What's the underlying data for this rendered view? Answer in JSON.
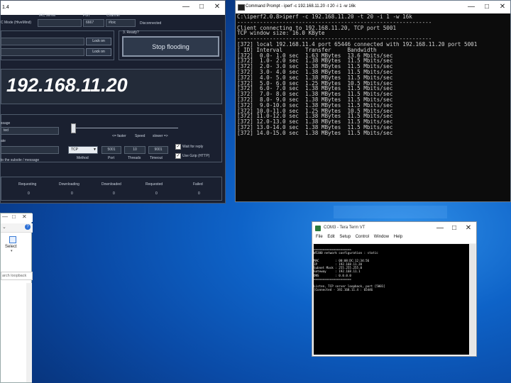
{
  "loic": {
    "title_fragment": "1.4",
    "irc_mode_label": "C Mode (HiveMind)",
    "irc_server_label": "IRC server",
    "port_label": "Port",
    "port_value": "6667",
    "channel_label": "Channel",
    "channel_value": "#loic",
    "disconnected": "Disconnected",
    "lock_on_1": "Lock on",
    "lock_on_2": "Lock on",
    "ready_label": "3. Ready?",
    "stop_flooding": "Stop flooding",
    "target_ip": "192.168.11.20",
    "message_label": "ssage",
    "message_value": "ted",
    "subsite_label": "ate",
    "subsite_note": "to the subsite / message",
    "faster_label": "<= faster",
    "speed_label": "Speed",
    "slower_label": "slower =>",
    "method_value": "TCP",
    "method_label": "Method",
    "port2_value": "5001",
    "port2_label": "Port",
    "threads_value": "10",
    "threads_label": "Threads",
    "timeout_value": "9001",
    "timeout_label": "Timeout",
    "wait_reply": "Wait for reply",
    "use_gzip": "Use Gzip (HTTP)",
    "stats": {
      "headers": [
        "Requesting",
        "Downloading",
        "Downloaded",
        "Requested",
        "Failed"
      ],
      "values": [
        "0",
        "0",
        "0",
        "0",
        "0"
      ],
      "first_value": "0"
    }
  },
  "cmd": {
    "title": "Command Prompt - iperf -c 192.168.11.20 -t 20 -i 1 -w 16k",
    "lines": [
      "C:\\iperf2.0.8>iperf -c 192.168.11.20 -t 20 -i 1 -w 16k",
      "------------------------------------------------------------",
      "Client connecting to 192.168.11.20, TCP port 5001",
      "TCP window size: 16.0 KByte",
      "------------------------------------------------------------",
      "[372] local 192.168.11.4 port 65446 connected with 192.168.11.20 port 5001",
      "[ ID] Interval       Transfer     Bandwidth",
      "[372]  0.0- 1.0 sec  1.63 MBytes  13.6 Mbits/sec",
      "[372]  1.0- 2.0 sec  1.38 MBytes  11.5 Mbits/sec",
      "[372]  2.0- 3.0 sec  1.38 MBytes  11.5 Mbits/sec",
      "[372]  3.0- 4.0 sec  1.38 MBytes  11.5 Mbits/sec",
      "[372]  4.0- 5.0 sec  1.38 MBytes  11.5 Mbits/sec",
      "[372]  5.0- 6.0 sec  1.25 MBytes  10.5 Mbits/sec",
      "[372]  6.0- 7.0 sec  1.38 MBytes  11.5 Mbits/sec",
      "[372]  7.0- 8.0 sec  1.38 MBytes  11.5 Mbits/sec",
      "[372]  8.0- 9.0 sec  1.38 MBytes  11.5 Mbits/sec",
      "[372]  9.0-10.0 sec  1.38 MBytes  11.5 Mbits/sec",
      "[372] 10.0-11.0 sec  1.25 MBytes  10.5 Mbits/sec",
      "[372] 11.0-12.0 sec  1.38 MBytes  11.5 Mbits/sec",
      "[372] 12.0-13.0 sec  1.38 MBytes  11.5 Mbits/sec",
      "[372] 13.0-14.0 sec  1.38 MBytes  11.5 Mbits/sec",
      "[372] 14.0-15.0 sec  1.38 MBytes  11.5 Mbits/sec"
    ]
  },
  "explorer": {
    "select_label": "Select",
    "search_placeholder": "arch loopback"
  },
  "tera": {
    "title": "COM3 - Tera Term VT",
    "menu": [
      "File",
      "Edit",
      "Setup",
      "Control",
      "Window",
      "Help"
    ],
    "lines": [
      "",
      "=====================",
      "W5300 network configuration : static",
      "",
      "MAC         : 00:08:DC:12:34:56",
      "IP          : 192.168.11.20",
      "Subnet Mask : 255.255.255.0",
      "Gateway     : 192.168.11.1",
      "DNS         : 0.0.0.0",
      "=====================",
      "",
      "Listen, TCP server loopback, port [5001]",
      "[Connected - 192.168.11.4 : 65446"
    ]
  }
}
